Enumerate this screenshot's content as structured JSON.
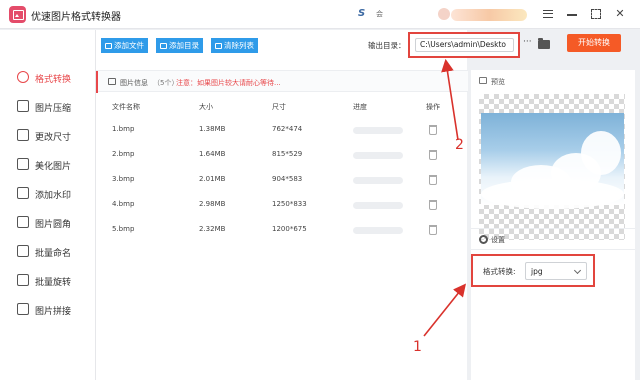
{
  "app": {
    "title": "优速图片格式转换器",
    "logo_mark": "S",
    "mini_text": "会"
  },
  "window": {
    "menu_icon": "hamburger-icon",
    "minimize_icon": "minimize-icon",
    "maximize_icon": "maximize-icon",
    "close_glyph": "✕"
  },
  "sidebar": {
    "items": [
      {
        "label": "格式转换",
        "icon": "refresh-icon",
        "active": true
      },
      {
        "label": "图片压缩",
        "icon": "compress-icon"
      },
      {
        "label": "更改尺寸",
        "icon": "resize-icon"
      },
      {
        "label": "美化图片",
        "icon": "beautify-icon"
      },
      {
        "label": "添加水印",
        "icon": "watermark-icon"
      },
      {
        "label": "图片圆角",
        "icon": "round-corner-icon"
      },
      {
        "label": "批量命名",
        "icon": "rename-icon"
      },
      {
        "label": "批量旋转",
        "icon": "rotate-icon"
      },
      {
        "label": "图片拼接",
        "icon": "stitch-icon"
      }
    ]
  },
  "toolbar": {
    "add_file": "添加文件",
    "add_dir": "添加目录",
    "clear_list": "清除列表"
  },
  "output": {
    "label": "输出目录：",
    "path": "C:\\Users\\admin\\Deskto",
    "more": "···",
    "start": "开始转换"
  },
  "file_info": {
    "label": "图片信息",
    "count": "（5个）",
    "note": "注意：如果图片较大请耐心等待..."
  },
  "table": {
    "headers": [
      "文件名称",
      "大小",
      "尺寸",
      "进度",
      "操作"
    ],
    "rows": [
      {
        "name": "1.bmp",
        "size": "1.38MB",
        "dims": "762*474",
        "progress": 0
      },
      {
        "name": "2.bmp",
        "size": "1.64MB",
        "dims": "815*529",
        "progress": 0
      },
      {
        "name": "3.bmp",
        "size": "2.01MB",
        "dims": "904*583",
        "progress": 0
      },
      {
        "name": "4.bmp",
        "size": "2.98MB",
        "dims": "1250*833",
        "progress": 0
      },
      {
        "name": "5.bmp",
        "size": "2.32MB",
        "dims": "1200*675",
        "progress": 0
      }
    ]
  },
  "preview": {
    "label": "预览"
  },
  "settings": {
    "label": "设置",
    "format_label": "格式转换:",
    "format_value": "jpg"
  },
  "annotations": {
    "one": "1",
    "two": "2",
    "color": "#d9322c"
  },
  "colors": {
    "accent_red": "#e8474a",
    "toolbar_blue": "#2f9be9",
    "start_orange": "#f55a26",
    "highlight_red": "#e2453e"
  }
}
